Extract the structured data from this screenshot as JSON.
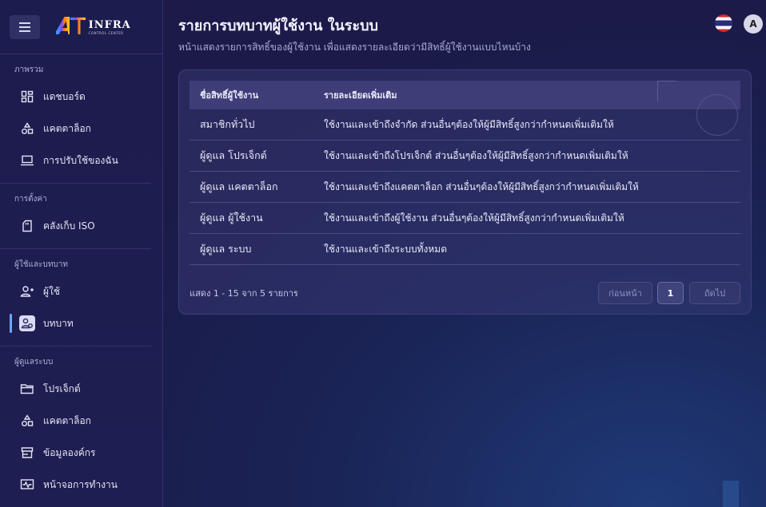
{
  "sidebar": {
    "logo": {
      "mark": "A",
      "title": "INFRA",
      "subtitle": "CONTROL CENTER"
    },
    "sections": [
      {
        "title": "ภาพรวม",
        "items": [
          {
            "label": "แดชบอร์ด",
            "icon": "dashboard-icon"
          },
          {
            "label": "แคตตาล็อก",
            "icon": "catalog-icon"
          },
          {
            "label": "การปรับใช้ของฉัน",
            "icon": "laptop-icon"
          }
        ]
      },
      {
        "title": "การตั้งค่า",
        "items": [
          {
            "label": "คลังเก็บ ISO",
            "icon": "sd-card-icon"
          }
        ]
      },
      {
        "title": "ผู้ใช้และบทบาท",
        "items": [
          {
            "label": "ผู้ใช้",
            "icon": "user-icon"
          },
          {
            "label": "บทบาท",
            "icon": "role-icon",
            "active": true
          }
        ]
      },
      {
        "title": "ผู้ดูแลระบบ",
        "items": [
          {
            "label": "โปรเจ็กต์",
            "icon": "folder-icon"
          },
          {
            "label": "แคตตาล็อก",
            "icon": "catalog-icon"
          },
          {
            "label": "ข้อมูลองค์กร",
            "icon": "store-icon"
          },
          {
            "label": "หน้าจอการทำงาน",
            "icon": "monitor-icon"
          }
        ]
      }
    ]
  },
  "header": {
    "title": "รายการบทบาทผู้ใช้งาน ในระบบ",
    "subtitle": "หน้าแสดงรายการสิทธิ์ของผู้ใช้งาน เพื่อแสดงรายละเอียดว่ามีสิทธิ์ผู้ใช้งานแบบไหนบ้าง",
    "avatar_letter": "A"
  },
  "table": {
    "headers": {
      "name": "ชื่อสิทธิ์ผู้ใช้งาน",
      "desc": "รายละเอียดเพิ่มเติม"
    },
    "rows": [
      {
        "name": "สมาชิกทั่วไป",
        "desc": "ใช้งานและเข้าถึงจำกัด ส่วนอื่นๆต้องให้ผู้มีสิทธิ์สูงกว่ากำหนดเพิ่มเติมให้"
      },
      {
        "name": "ผู้ดูแล โปรเจ็กต์",
        "desc": "ใช้งานและเข้าถึงโปรเจ็กต์ ส่วนอื่นๆต้องให้ผู้มีสิทธิ์สูงกว่ากำหนดเพิ่มเติมให้"
      },
      {
        "name": "ผู้ดูแล แคตตาล็อก",
        "desc": "ใช้งานและเข้าถึงแคตตาล็อก ส่วนอื่นๆต้องให้ผู้มีสิทธิ์สูงกว่ากำหนดเพิ่มเติมให้"
      },
      {
        "name": "ผู้ดูแล ผู้ใช้งาน",
        "desc": "ใช้งานและเข้าถึงผู้ใช้งาน ส่วนอื่นๆต้องให้ผู้มีสิทธิ์สูงกว่ากำหนดเพิ่มเติมให้"
      },
      {
        "name": "ผู้ดูแล ระบบ",
        "desc": "ใช้งานและเข้าถึงระบบทั้งหมด"
      }
    ]
  },
  "pagination": {
    "summary": "แสดง 1 - 15 จาก 5 รายการ",
    "prev_label": "ก่อนหน้า",
    "current_page": "1",
    "next_label": "ถัดไป"
  }
}
